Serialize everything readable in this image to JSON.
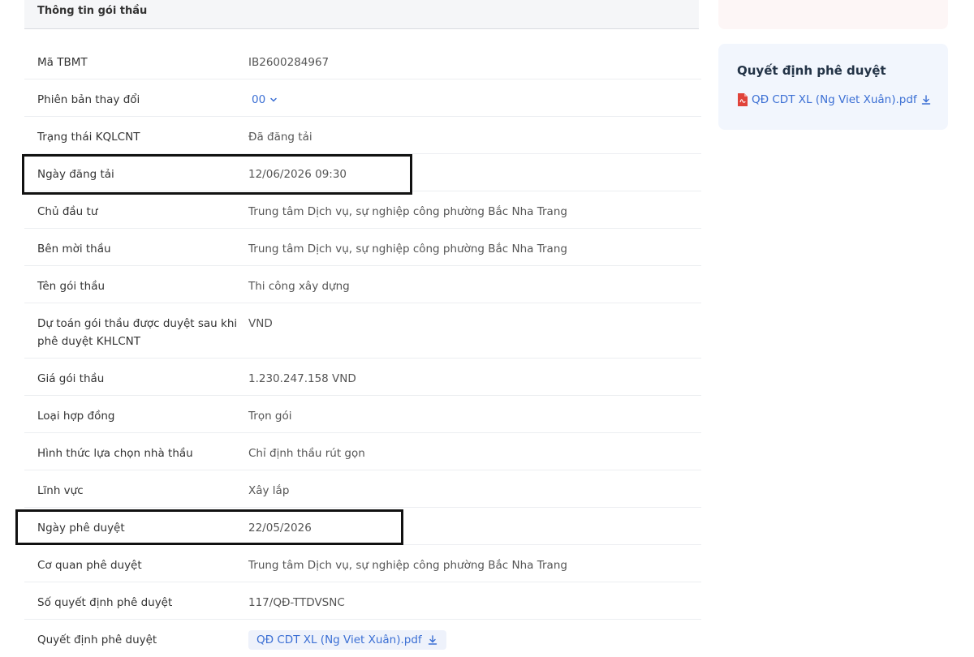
{
  "section": {
    "title": "Thông tin gói thầu"
  },
  "rows": [
    {
      "label": "Mã TBMT",
      "value": "IB2600284967"
    },
    {
      "label": "Phiên bản thay đổi",
      "value": "00"
    },
    {
      "label": "Trạng thái KQLCNT",
      "value": "Đã đăng tải"
    },
    {
      "label": "Ngày đăng tải",
      "value": "12/06/2026 09:30"
    },
    {
      "label": "Chủ đầu tư",
      "value": "Trung tâm Dịch vụ, sự nghiệp công phường Bắc Nha Trang"
    },
    {
      "label": "Bên mời thầu",
      "value": "Trung tâm Dịch vụ, sự nghiệp công phường Bắc Nha Trang"
    },
    {
      "label": "Tên gói thầu",
      "value": "Thi công xây dựng"
    },
    {
      "label": "Dự toán gói thầu được duyệt sau khi phê duyệt KHLCNT",
      "value": "VND"
    },
    {
      "label": "Giá gói thầu",
      "value": "1.230.247.158 VND"
    },
    {
      "label": "Loại hợp đồng",
      "value": "Trọn gói"
    },
    {
      "label": "Hình thức lựa chọn nhà thầu",
      "value": "Chỉ định thầu rút gọn"
    },
    {
      "label": "Lĩnh vực",
      "value": "Xây lắp"
    },
    {
      "label": "Ngày phê duyệt",
      "value": "22/05/2026"
    },
    {
      "label": "Cơ quan phê duyệt",
      "value": "Trung tâm Dịch vụ, sự nghiệp công phường Bắc Nha Trang"
    },
    {
      "label": "Số quyết định phê duyệt",
      "value": "117/QĐ-TTDVSNC"
    },
    {
      "label": "Quyết định phê duyệt",
      "value": "QĐ CDT XL (Ng Viet Xuân).pdf"
    }
  ],
  "side_card": {
    "title": "Quyết định phê duyệt",
    "file_name": "QĐ CDT XL (Ng Viet Xuân).pdf"
  },
  "colors": {
    "link": "#3b6fd4",
    "pdf": "#e0433a",
    "highlight_border": "#111111"
  }
}
